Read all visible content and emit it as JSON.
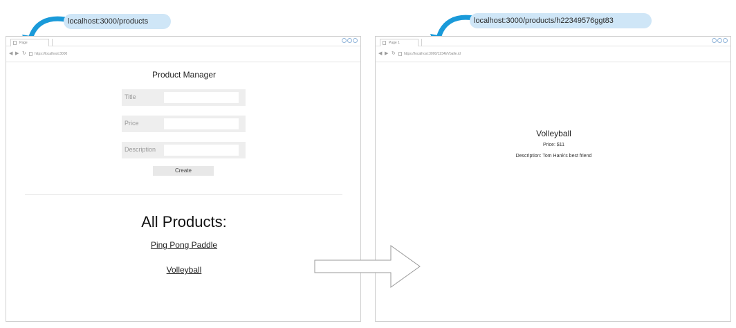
{
  "left_browser": {
    "tab_label": "Page",
    "url": "https://localhost:3000",
    "nav_icons": [
      "back-arrow-icon",
      "forward-arrow-icon",
      "refresh-icon"
    ],
    "title": "Product Manager",
    "form": {
      "title_label": "Title",
      "title_value": "",
      "price_label": "Price",
      "price_value": "",
      "description_label": "Description",
      "description_value": "",
      "create_label": "Create"
    },
    "all_products_heading": "All Products:",
    "products": [
      "Ping Pong Paddle",
      "Volleyball"
    ]
  },
  "right_browser": {
    "tab_label": "Page 1",
    "url": "https://localhost:3000/1234t/Vballe.id",
    "product": {
      "name": "Volleyball",
      "price": "Price: $11",
      "description": "Description: Tom Hank's best friend"
    }
  },
  "annotations": {
    "left_url": "localhost:3000/products",
    "right_url": "localhost:3000/products/h22349576ggt83"
  },
  "colors": {
    "accent_arrow": "#1a9ad9",
    "bubble_bg": "#cfe6f7",
    "window_controls": "#8fb3d9"
  }
}
